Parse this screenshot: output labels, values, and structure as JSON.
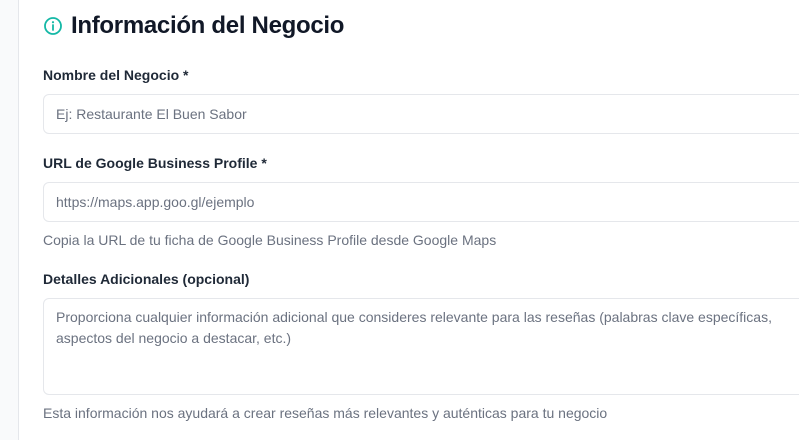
{
  "section": {
    "title": "Información del Negocio",
    "icon": "info-icon",
    "icon_color": "#14b8a6"
  },
  "fields": {
    "business_name": {
      "label": "Nombre del Negocio *",
      "placeholder": "Ej: Restaurante El Buen Sabor",
      "value": ""
    },
    "google_url": {
      "label": "URL de Google Business Profile *",
      "placeholder": "https://maps.app.goo.gl/ejemplo",
      "value": "",
      "help": "Copia la URL de tu ficha de Google Business Profile desde Google Maps"
    },
    "details": {
      "label": "Detalles Adicionales (opcional)",
      "placeholder": "Proporciona cualquier información adicional que consideres relevante para las reseñas (palabras clave específicas, aspectos del negocio a destacar, etc.)",
      "value": "",
      "help": "Esta información nos ayudará a crear reseñas más relevantes y auténticas para tu negocio"
    }
  }
}
